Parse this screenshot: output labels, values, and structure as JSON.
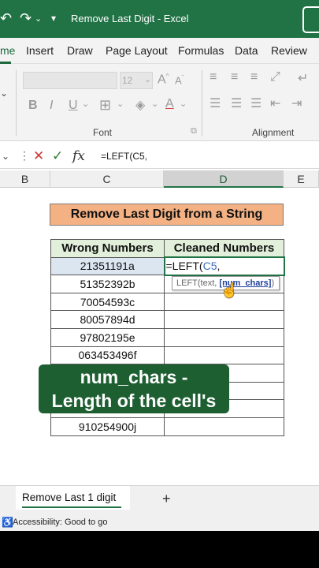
{
  "titlebar": {
    "title": "Remove Last Digit  -  Excel",
    "icons": [
      "undo-icon",
      "redo-icon",
      "quick-access-dropdown-icon"
    ]
  },
  "tabs": [
    "me",
    "Insert",
    "Draw",
    "Page Layout",
    "Formulas",
    "Data",
    "Review"
  ],
  "active_tab": "me",
  "ribbon": {
    "font_size": "12",
    "font_group_label": "Font",
    "alignment_group_label": "Alignment",
    "font_buttons": [
      "B",
      "I",
      "U"
    ]
  },
  "formula_bar": {
    "formula": "=LEFT(C5,"
  },
  "columns": [
    "B",
    "C",
    "D",
    "E"
  ],
  "banner": "Remove Last Digit from a String",
  "table": {
    "headers": [
      "Wrong Numbers",
      "Cleaned Numbers"
    ],
    "rows": [
      {
        "wrong": "21351191a",
        "clean": ""
      },
      {
        "wrong": "51352392b",
        "clean": ""
      },
      {
        "wrong": "70054593c",
        "clean": ""
      },
      {
        "wrong": "80057894d",
        "clean": ""
      },
      {
        "wrong": "97802195e",
        "clean": ""
      },
      {
        "wrong": "063453496f",
        "clean": ""
      },
      {
        "wrong": "",
        "clean": ""
      },
      {
        "wrong": "",
        "clean": ""
      },
      {
        "wrong": "",
        "clean": ""
      },
      {
        "wrong": "910254900j",
        "clean": ""
      }
    ],
    "active_formula": {
      "prefix": "=LEFT(",
      "ref": "C5",
      "suffix": ","
    }
  },
  "tooltip": {
    "prefix": "LEFT(text, ",
    "arg": "[num_chars]",
    "suffix": ")"
  },
  "caption": {
    "line1": "num_chars -",
    "line2": "Length of the cell's"
  },
  "sheet_tab": "Remove Last 1 digit",
  "add_sheet": "+",
  "status": "Accessibility: Good to go",
  "colors": {
    "excel_green": "#217346",
    "banner": "#f4b183",
    "header_fill": "#e2efda",
    "caption_bg": "#1e5f32"
  }
}
